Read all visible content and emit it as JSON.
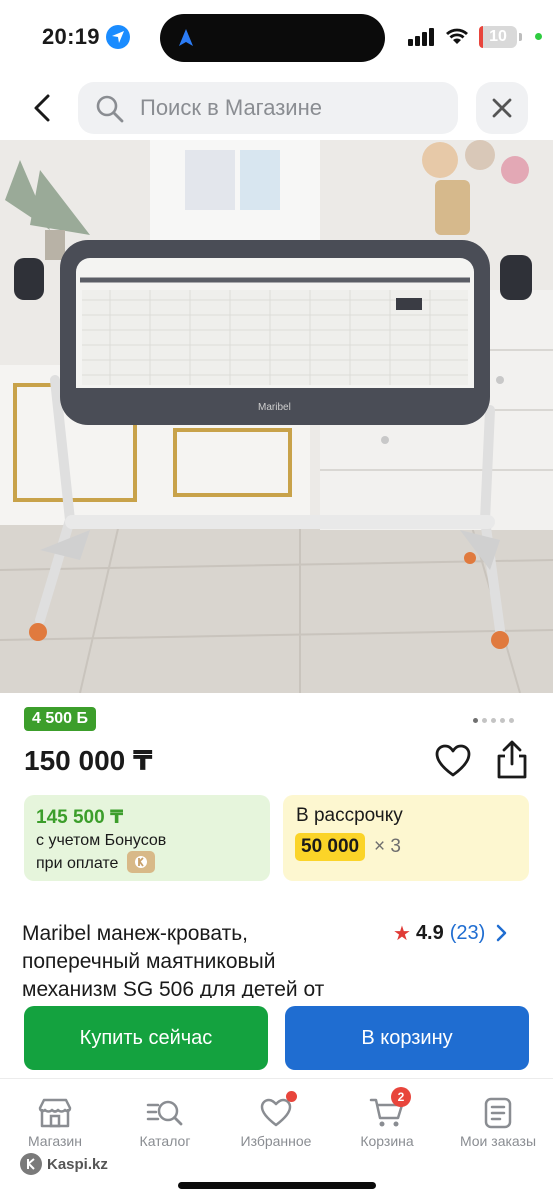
{
  "status_bar": {
    "time": "20:19",
    "battery": "10",
    "battery_level": 0.1
  },
  "search": {
    "placeholder": "Поиск в Магазине"
  },
  "product": {
    "bonus_badge": "4 500 Б",
    "price": "150 000 ₸",
    "image_count": 5,
    "active_image": 0,
    "title": "Maribel манеж-кровать, поперечный маятниковый механизм SG 506 для детей от",
    "rating": "4.9",
    "reviews": "(23)",
    "bonus_card": {
      "amount": "145 500 ₸",
      "line1": "с учетом Бонусов",
      "line2": "при оплате"
    },
    "credit_card": {
      "title": "В рассрочку",
      "amount": "50 000",
      "multiplier": "× 3"
    }
  },
  "actions": {
    "buy_now": "Купить сейчас",
    "add_to_cart": "В корзину"
  },
  "nav": {
    "items": [
      {
        "label": "Магазин",
        "icon": "store-icon"
      },
      {
        "label": "Каталог",
        "icon": "catalog-icon"
      },
      {
        "label": "Избранное",
        "icon": "heart-icon"
      },
      {
        "label": "Корзина",
        "icon": "cart-icon"
      },
      {
        "label": "Мои заказы",
        "icon": "orders-icon"
      }
    ],
    "cart_badge": "2"
  },
  "brand": "Kaspi.kz",
  "colors": {
    "bonus_green": "#3c9e2b",
    "buy_green": "#14a23f",
    "cart_blue": "#1f6dd1",
    "credit_yellow": "#fbd428",
    "star_red": "#e03b36"
  }
}
